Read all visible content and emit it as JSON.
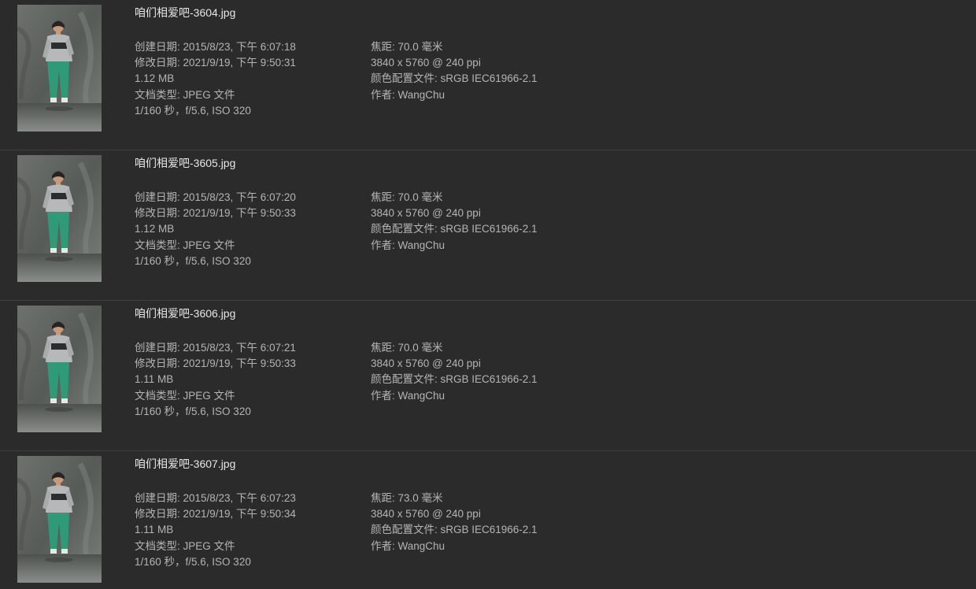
{
  "files": [
    {
      "name": "咱们相爱吧-3604.jpg",
      "created": "创建日期: 2015/8/23, 下午 6:07:18",
      "modified": "修改日期: 2021/9/19, 下午 9:50:31",
      "size": "1.12 MB",
      "kind": "文档类型: JPEG 文件",
      "exposure": "1/160 秒，f/5.6, ISO 320",
      "focal_length": "焦距: 70.0 毫米",
      "dimensions": "3840 x 5760 @ 240 ppi",
      "color_profile": "颜色配置文件: sRGB IEC61966-2.1",
      "author": "作者: WangChu"
    },
    {
      "name": "咱们相爱吧-3605.jpg",
      "created": "创建日期: 2015/8/23, 下午 6:07:20",
      "modified": "修改日期: 2021/9/19, 下午 9:50:33",
      "size": "1.12 MB",
      "kind": "文档类型: JPEG 文件",
      "exposure": "1/160 秒，f/5.6, ISO 320",
      "focal_length": "焦距: 70.0 毫米",
      "dimensions": "3840 x 5760 @ 240 ppi",
      "color_profile": "颜色配置文件: sRGB IEC61966-2.1",
      "author": "作者: WangChu"
    },
    {
      "name": "咱们相爱吧-3606.jpg",
      "created": "创建日期: 2015/8/23, 下午 6:07:21",
      "modified": "修改日期: 2021/9/19, 下午 9:50:33",
      "size": "1.11 MB",
      "kind": "文档类型: JPEG 文件",
      "exposure": "1/160 秒，f/5.6, ISO 320",
      "focal_length": "焦距: 70.0 毫米",
      "dimensions": "3840 x 5760 @ 240 ppi",
      "color_profile": "颜色配置文件: sRGB IEC61966-2.1",
      "author": "作者: WangChu"
    },
    {
      "name": "咱们相爱吧-3607.jpg",
      "created": "创建日期: 2015/8/23, 下午 6:07:23",
      "modified": "修改日期: 2021/9/19, 下午 9:50:34",
      "size": "1.11 MB",
      "kind": "文档类型: JPEG 文件",
      "exposure": "1/160 秒，f/5.6, ISO 320",
      "focal_length": "焦距: 73.0 毫米",
      "dimensions": "3840 x 5760 @ 240 ppi",
      "color_profile": "颜色配置文件: sRGB IEC61966-2.1",
      "author": "作者: WangChu"
    }
  ],
  "colors": {
    "background": "#2b2b2b",
    "title_text": "#e6e6e6",
    "detail_text": "#b4b4b4",
    "divider": "#3e3e3e"
  }
}
